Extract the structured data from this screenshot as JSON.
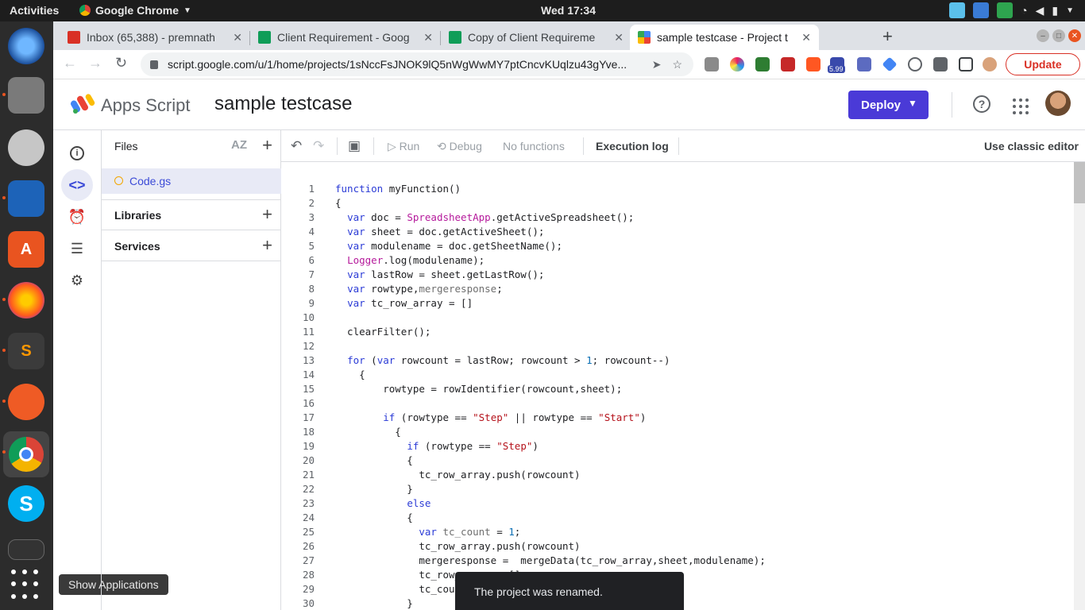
{
  "topbar": {
    "activities": "Activities",
    "app_menu": "Google Chrome",
    "clock": "Wed 17:34"
  },
  "dock": {
    "tooltip": "Show Applications"
  },
  "chrome": {
    "tabs": [
      {
        "title": "Inbox (65,388) - premnath",
        "favicon_color": "#d93025"
      },
      {
        "title": "Client Requirement - Goog",
        "favicon_color": "#0f9d58"
      },
      {
        "title": "Copy of Client Requireme",
        "favicon_color": "#0f9d58"
      },
      {
        "title": "sample testcase - Project t",
        "favicon_color": "#4285f4"
      }
    ],
    "new_tab": "+",
    "url": "script.google.com/u/1/home/projects/1sNccFsJNOK9lQ5nWgWwMY7ptCncvKUqlzu43gYve...",
    "extension_badge": "5.99",
    "update_label": "Update"
  },
  "apps_script": {
    "brand": "Apps Script",
    "project_title": "sample testcase",
    "deploy_label": "Deploy",
    "files_header": "Files",
    "sort_icon": "AZ",
    "file_name": "Code.gs",
    "libraries_label": "Libraries",
    "services_label": "Services",
    "toolbar": {
      "run": "Run",
      "debug": "Debug",
      "function_select": "No functions",
      "execution_log": "Execution log",
      "classic_editor": "Use classic editor"
    },
    "toast": "The project was renamed."
  },
  "code_lines": [
    [
      [
        "kw",
        "function"
      ],
      [
        "t",
        " myFunction()"
      ]
    ],
    [
      [
        "t",
        "{"
      ]
    ],
    [
      [
        "t",
        "  "
      ],
      [
        "kw",
        "var"
      ],
      [
        "t",
        " doc = "
      ],
      [
        "cls",
        "SpreadsheetApp"
      ],
      [
        "t",
        ".getActiveSpreadsheet();"
      ]
    ],
    [
      [
        "t",
        "  "
      ],
      [
        "kw",
        "var"
      ],
      [
        "t",
        " sheet = doc.getActiveSheet();"
      ]
    ],
    [
      [
        "t",
        "  "
      ],
      [
        "kw",
        "var"
      ],
      [
        "t",
        " modulename = doc.getSheetName();"
      ]
    ],
    [
      [
        "t",
        "  "
      ],
      [
        "cls",
        "Logger"
      ],
      [
        "t",
        ".log(modulename);"
      ]
    ],
    [
      [
        "t",
        "  "
      ],
      [
        "kw",
        "var"
      ],
      [
        "t",
        " lastRow = sheet.getLastRow();"
      ]
    ],
    [
      [
        "t",
        "  "
      ],
      [
        "kw",
        "var"
      ],
      [
        "t",
        " rowtype,"
      ],
      [
        "gry",
        "mergeresponse"
      ],
      [
        "t",
        ";"
      ]
    ],
    [
      [
        "t",
        "  "
      ],
      [
        "kw",
        "var"
      ],
      [
        "t",
        " tc_row_array = []"
      ]
    ],
    [
      [
        "t",
        ""
      ]
    ],
    [
      [
        "t",
        "  clearFilter();"
      ]
    ],
    [
      [
        "t",
        ""
      ]
    ],
    [
      [
        "t",
        "  "
      ],
      [
        "kw",
        "for"
      ],
      [
        "t",
        " ("
      ],
      [
        "kw",
        "var"
      ],
      [
        "t",
        " rowcount = lastRow; rowcount > "
      ],
      [
        "num",
        "1"
      ],
      [
        "t",
        "; rowcount--)"
      ]
    ],
    [
      [
        "t",
        "    {"
      ]
    ],
    [
      [
        "t",
        "        rowtype = rowIdentifier(rowcount,sheet);"
      ]
    ],
    [
      [
        "t",
        ""
      ]
    ],
    [
      [
        "t",
        "        "
      ],
      [
        "kw",
        "if"
      ],
      [
        "t",
        " (rowtype == "
      ],
      [
        "str",
        "\"Step\""
      ],
      [
        "t",
        " || rowtype == "
      ],
      [
        "str",
        "\"Start\""
      ],
      [
        "t",
        ")"
      ]
    ],
    [
      [
        "t",
        "          {"
      ]
    ],
    [
      [
        "t",
        "            "
      ],
      [
        "kw",
        "if"
      ],
      [
        "t",
        " (rowtype == "
      ],
      [
        "str",
        "\"Step\""
      ],
      [
        "t",
        ")"
      ]
    ],
    [
      [
        "t",
        "            {"
      ]
    ],
    [
      [
        "t",
        "              tc_row_array.push(rowcount)"
      ]
    ],
    [
      [
        "t",
        "            }"
      ]
    ],
    [
      [
        "t",
        "            "
      ],
      [
        "kw",
        "else"
      ]
    ],
    [
      [
        "t",
        "            {"
      ]
    ],
    [
      [
        "t",
        "              "
      ],
      [
        "kw",
        "var"
      ],
      [
        "t",
        " "
      ],
      [
        "gry",
        "tc_count"
      ],
      [
        "t",
        " = "
      ],
      [
        "num",
        "1"
      ],
      [
        "t",
        ";"
      ]
    ],
    [
      [
        "t",
        "              tc_row_array.push(rowcount)"
      ]
    ],
    [
      [
        "t",
        "              mergeresponse =  mergeData(tc_row_array,sheet,modulename);"
      ]
    ],
    [
      [
        "t",
        "              tc_row_array = []"
      ]
    ],
    [
      [
        "t",
        "              tc_count = 0"
      ]
    ],
    [
      [
        "t",
        "            }"
      ]
    ]
  ]
}
